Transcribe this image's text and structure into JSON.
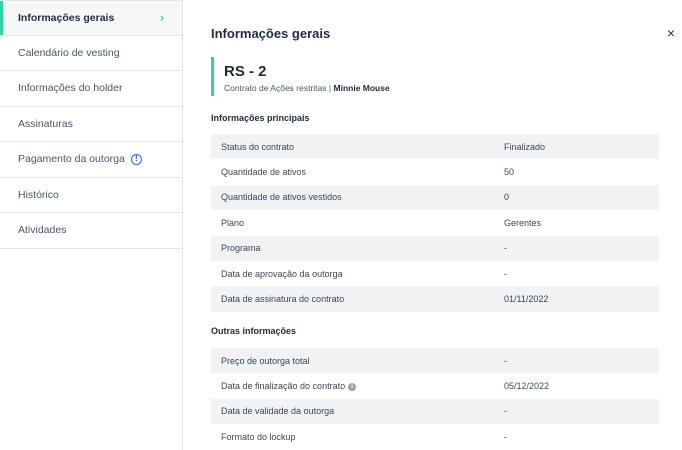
{
  "sidebar": {
    "items": [
      {
        "label": "Informações gerais",
        "active": true
      },
      {
        "label": "Calendário de vesting"
      },
      {
        "label": "Informações do holder"
      },
      {
        "label": "Assinaturas"
      },
      {
        "label": "Pagamento da outorga",
        "alert": true
      },
      {
        "label": "Histórico"
      },
      {
        "label": "Atividades"
      }
    ]
  },
  "header": {
    "title": "Informações gerais",
    "close_glyph": "×"
  },
  "contract": {
    "id": "RS - 2",
    "type": "Contrato de Ações restritas",
    "separator": "|",
    "holder": "Minnie Mouse"
  },
  "main_info": {
    "title": "Informações principais",
    "rows": [
      {
        "label": "Status do contrato",
        "value": "Finalizado"
      },
      {
        "label": "Quantidade de ativos",
        "value": "50"
      },
      {
        "label": "Quantidade de ativos vestidos",
        "value": "0"
      },
      {
        "label": "Plano",
        "value": "Gerentes"
      },
      {
        "label": "Programa",
        "value": "-"
      },
      {
        "label": "Data de aprovação da outorga",
        "value": "-"
      },
      {
        "label": "Data de assinatura do contrato",
        "value": "01/11/2022"
      }
    ]
  },
  "other_info": {
    "title": "Outras informações",
    "rows": [
      {
        "label": "Preço de outorga total",
        "value": "-"
      },
      {
        "label": "Data de finalização do contrato",
        "value": "05/12/2022",
        "has_info_icon": true
      },
      {
        "label": "Data de validade da outorga",
        "value": "-"
      },
      {
        "label": "Formato do lockup",
        "value": "-"
      }
    ]
  },
  "colors": {
    "accent": "#2fd3a0",
    "alert": "#2b63e0",
    "row_shade": "#f1f2f4"
  }
}
